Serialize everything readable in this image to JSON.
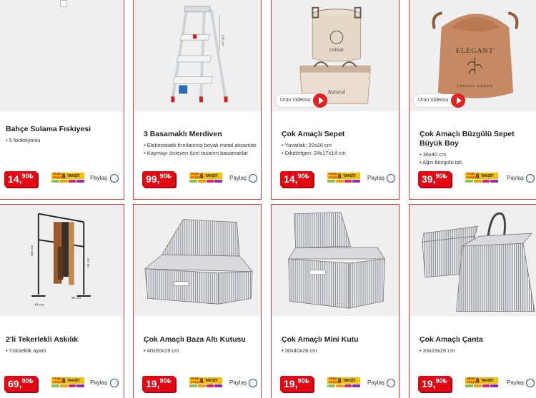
{
  "products": [
    {
      "title": "Bahçe Sulama Fıskiyesi",
      "features": [
        "5 fonksiyonlu"
      ],
      "price_int": "14,",
      "price_dec": "90₺",
      "video": "",
      "image": "broken-image-icon"
    },
    {
      "title": "3 Basamaklı Merdiven",
      "features": [
        "Elektrostatik fırınlanmış boyalı metal aksamlar",
        "Kaymayı önleyen özel tasarım basamaklar"
      ],
      "price_int": "99,",
      "price_dec": "90₺",
      "video": "",
      "image": "ladder-image",
      "dims": "105 cm"
    },
    {
      "title": "Çok Amaçlı Sepet",
      "features": [
        "Yuvarlak: 20x20 cm",
        "Dikdörtgen: 24x17x14 cm"
      ],
      "price_int": "14,",
      "price_dec": "90₺",
      "video": "Ürün Videosu",
      "image": "fabric-baskets-image",
      "print1": "cotton",
      "print2": "Natural"
    },
    {
      "title": "Çok Amaçlı Büzgülü Sepet Büyük Boy",
      "features": [
        "36x40 cm",
        "Ağzı büzgülü ipli"
      ],
      "price_int": "39,",
      "price_dec": "90₺",
      "video": "Ürün Videosu",
      "image": "drawstring-basket-image",
      "print1": "ELEGANT",
      "print2": "TRENDY GREEN"
    },
    {
      "title": "2'li Tekerlekli Askılık",
      "features": [
        "Yükseklik ayarlı"
      ],
      "price_int": "69,",
      "price_dec": "90₺",
      "video": "",
      "image": "clothes-rack-image",
      "dims": [
        "156 cm",
        "91 cm",
        "80 cm",
        "43 cm"
      ]
    },
    {
      "title": "Çok Amaçlı Baza Altı Kutusu",
      "features": [
        "40x50x19 cm"
      ],
      "price_int": "19,",
      "price_dec": "90₺",
      "video": "",
      "image": "underbed-box-image"
    },
    {
      "title": "Çok Amaçlı Mini Kutu",
      "features": [
        "30x40x26 cm"
      ],
      "price_int": "19,",
      "price_dec": "90₺",
      "video": "",
      "image": "mini-box-image"
    },
    {
      "title": "Çok Amaçlı Çanta",
      "features": [
        "33x23x26 cm"
      ],
      "price_int": "19,",
      "price_dec": "90₺",
      "video": "",
      "image": "striped-bag-image"
    }
  ],
  "taksit": {
    "pesin": "PEŞİN FİYATINA",
    "count": "6",
    "label": "TAKSİT"
  },
  "share_label": "Paylaş",
  "colors": {
    "accent": "#e30613",
    "border": "#e23b3b",
    "image_bg": "#efefef"
  }
}
